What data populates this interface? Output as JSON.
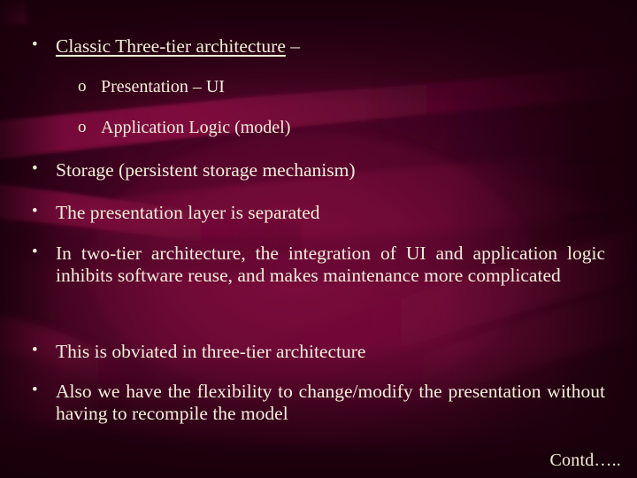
{
  "slide": {
    "background": {
      "base_dark": "#2a0012",
      "base_mid": "#4d0526",
      "base_light": "#7a0c3d",
      "wave_light": "#8e1045",
      "wave_dark": "#3a0320",
      "accent_notch": "#d41466",
      "text_color": "#f6efdc"
    },
    "bullets": [
      {
        "level": 1,
        "marker": "•",
        "underlined_text": "Classic Three-tier architecture",
        "trailing_text": " –"
      },
      {
        "level": 2,
        "marker": "o",
        "text": "Presentation – UI"
      },
      {
        "level": 2,
        "marker": "o",
        "text": "Application Logic (model)"
      },
      {
        "level": 1,
        "marker": "•",
        "text": "Storage (persistent storage mechanism)"
      },
      {
        "level": 1,
        "marker": "•",
        "text": "The presentation layer is separated"
      },
      {
        "level": 1,
        "marker": "•",
        "text": "In two-tier architecture, the integration of UI and application logic inhibits software reuse, and makes maintenance more complicated",
        "justified": true
      },
      {
        "level": 1,
        "marker": "•",
        "text": "This is obviated in three-tier architecture"
      },
      {
        "level": 1,
        "marker": "•",
        "text": "Also we have the flexibility to change/modify the presentation without having to recompile the model",
        "justified": true
      }
    ],
    "footer": {
      "continuation_label": "Contd….."
    }
  }
}
